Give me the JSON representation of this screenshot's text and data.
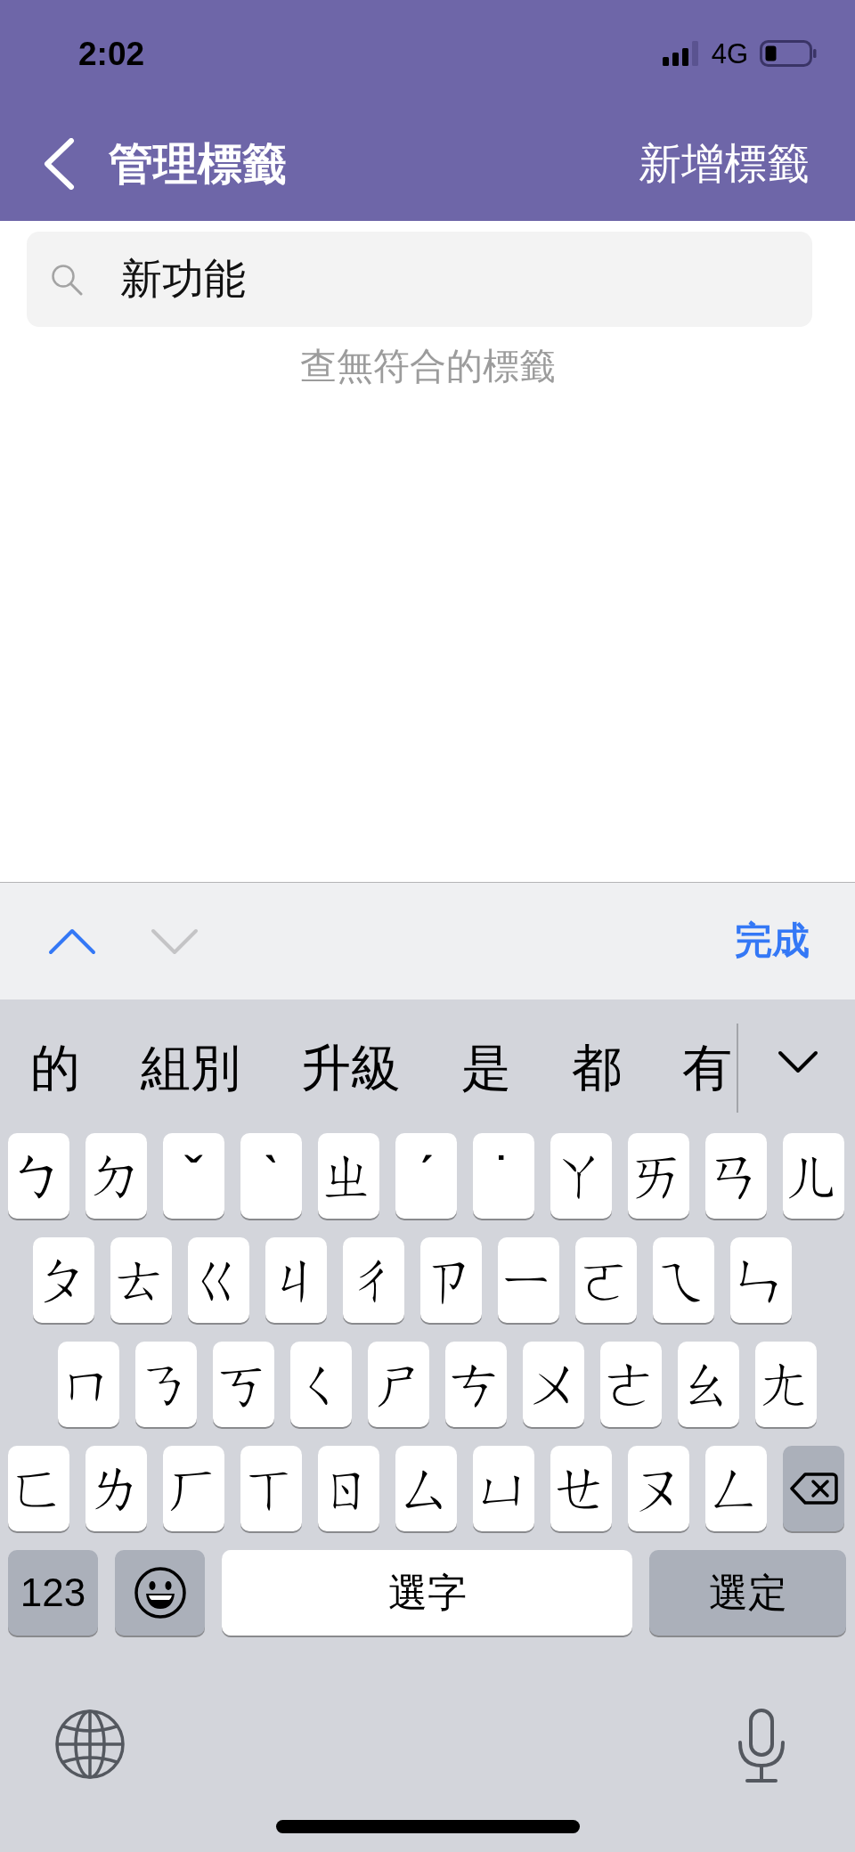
{
  "status_bar": {
    "time": "2:02",
    "network": "4G"
  },
  "nav_bar": {
    "title": "管理標籤",
    "action": "新增標籤"
  },
  "search": {
    "value": "新功能"
  },
  "empty_message": "查無符合的標籤",
  "keyboard_toolbar": {
    "previous": {
      "disabled": false
    },
    "next": {
      "disabled": true
    },
    "done": "完成"
  },
  "candidates": [
    "的",
    "組別",
    "升級",
    "是",
    "都",
    "有"
  ],
  "letter_rows": [
    [
      "ㄅ",
      "ㄉ",
      "ˇ",
      "ˋ",
      "ㄓ",
      "ˊ",
      "˙",
      "ㄚ",
      "ㄞ",
      "ㄢ",
      "ㄦ"
    ],
    [
      "ㄆ",
      "ㄊ",
      "ㄍ",
      "ㄐ",
      "ㄔ",
      "ㄗ",
      "ㄧ",
      "ㄛ",
      "ㄟ",
      "ㄣ"
    ],
    [
      "ㄇ",
      "ㄋ",
      "ㄎ",
      "ㄑ",
      "ㄕ",
      "ㄘ",
      "ㄨ",
      "ㄜ",
      "ㄠ",
      "ㄤ"
    ],
    [
      "ㄈ",
      "ㄌ",
      "ㄏ",
      "ㄒ",
      "ㄖ",
      "ㄙ",
      "ㄩ",
      "ㄝ",
      "ㄡ",
      "ㄥ"
    ]
  ],
  "bottom_row": [
    {
      "kind": "numbers",
      "label": "123"
    },
    {
      "kind": "emoji"
    },
    {
      "kind": "space",
      "label": "選字"
    },
    {
      "kind": "confirm",
      "label": "選定"
    }
  ]
}
